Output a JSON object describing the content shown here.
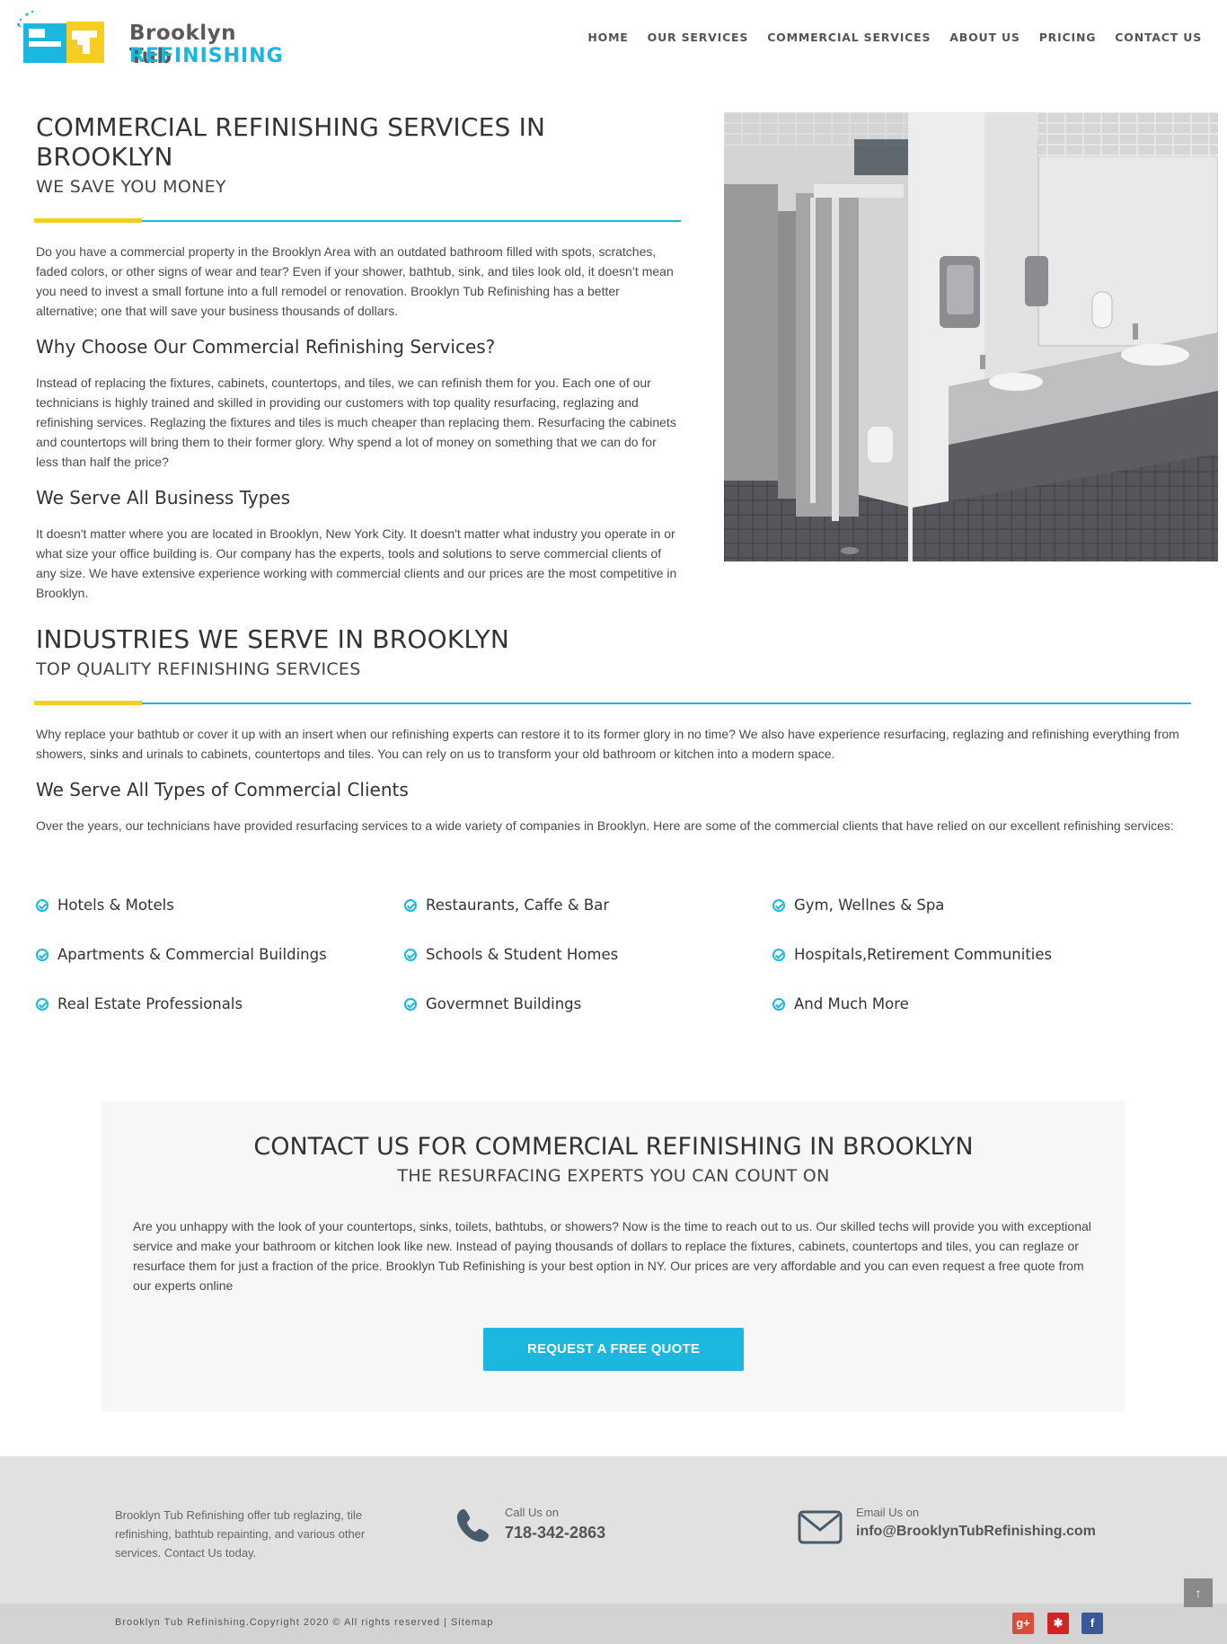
{
  "header": {
    "logo_line1": "Brooklyn Tub",
    "logo_line2": "REFINISHING",
    "nav": [
      "HOME",
      "OUR SERVICES",
      "COMMERCIAL SERVICES",
      "ABOUT US",
      "PRICING",
      "CONTACT US"
    ]
  },
  "section1": {
    "title": "COMMERCIAL REFINISHING SERVICES IN BROOKLYN",
    "subtitle": "WE SAVE YOU MONEY",
    "intro": "Do you have a commercial property in the Brooklyn Area with an outdated bathroom filled with spots, scratches, faded colors, or other signs of wear and tear? Even if your shower, bathtub, sink, and tiles look old, it doesn’t mean you need to invest a small fortune into a full remodel or renovation. Brooklyn Tub Refinishing has a better alternative; one that will save your business thousands of dollars.",
    "why_heading": "Why Choose Our Commercial Refinishing Services?",
    "why_text": "Instead of replacing the fixtures, cabinets, countertops, and tiles, we can refinish them for you. Each one of our technicians is highly trained and skilled in providing our customers with top quality resurfacing, reglazing and refinishing services. Reglazing the fixtures and tiles is much cheaper than replacing them. Resurfacing the cabinets and countertops will bring them to their former glory. Why spend a lot of money on something that we can do for less than half the price?",
    "serve_heading": "We Serve All Business Types",
    "serve_text": "It doesn't matter where you are located in Brooklyn, New York City. It doesn't matter what industry you operate in or what size your office building is. Our company has the experts, tools and solutions to serve commercial clients of any size. We have extensive experience working with commercial clients and our prices are the most competitive in Brooklyn."
  },
  "section2": {
    "title": "INDUSTRIES WE SERVE IN BROOKLYN",
    "subtitle": "TOP QUALITY REFINISHING SERVICES",
    "intro": "Why replace your bathtub or cover it up with an insert when our refinishing experts can restore it to its former glory in no time? We also have experience resurfacing, reglazing and refinishing everything from showers, sinks and urinals to cabinets, countertops and tiles. You can rely on us to transform your old bathroom or kitchen into a modern space.",
    "clients_heading": "We Serve All Types of Commercial Clients",
    "clients_text": "Over the years, our technicians have provided resurfacing services to a wide variety of companies in Brooklyn. Here are some of the commercial clients that have relied on our excellent refinishing services:",
    "clients": [
      "Hotels & Motels",
      "Restaurants, Caffe & Bar",
      "Gym, Wellnes & Spa",
      "Apartments & Commercial Buildings",
      "Schools & Student Homes",
      "Hospitals,Retirement Communities",
      "Real Estate Professionals",
      "Govermnet Buildings",
      "And Much More"
    ]
  },
  "contact": {
    "title": "CONTACT US FOR COMMERCIAL REFINISHING IN BROOKLYN",
    "subtitle": "THE RESURFACING EXPERTS YOU CAN COUNT ON",
    "text": "Are you unhappy with the look of your countertops, sinks, toilets, bathtubs, or showers? Now is the time to reach out to us. Our skilled techs will provide you with exceptional service and make your bathroom or kitchen look like new. Instead of paying thousands of dollars to replace the fixtures, cabinets, countertops and tiles, you can reglaze or resurface them for just a fraction of the price. Brooklyn Tub Refinishing is your best option in NY. Our prices are very affordable and you can even request a free quote from our experts online",
    "button": "REQUEST A FREE QUOTE"
  },
  "footer": {
    "about": "Brooklyn Tub Refinishing offer tub reglazing, tile refinishing, bathtub repainting, and various other services. Contact Us today.",
    "call_label": "Call Us on",
    "phone": "718-342-2863",
    "email_label": "Email Us on",
    "email": "info@BrooklynTubRefinishing.com",
    "copyright": "Brooklyn Tub Refinishing.Copyright 2020 © All rights reserved |",
    "sitemap": "Sitemap",
    "to_top": "↑",
    "social": [
      {
        "icon": "google-plus-icon",
        "label": "g+",
        "color": "#dd4b39"
      },
      {
        "icon": "yelp-icon",
        "label": "✱",
        "color": "#d32323"
      },
      {
        "icon": "facebook-icon",
        "label": "f",
        "color": "#3b5998"
      }
    ]
  },
  "colors": {
    "accent_blue": "#1bb7de",
    "accent_yellow": "#f6cd23"
  }
}
